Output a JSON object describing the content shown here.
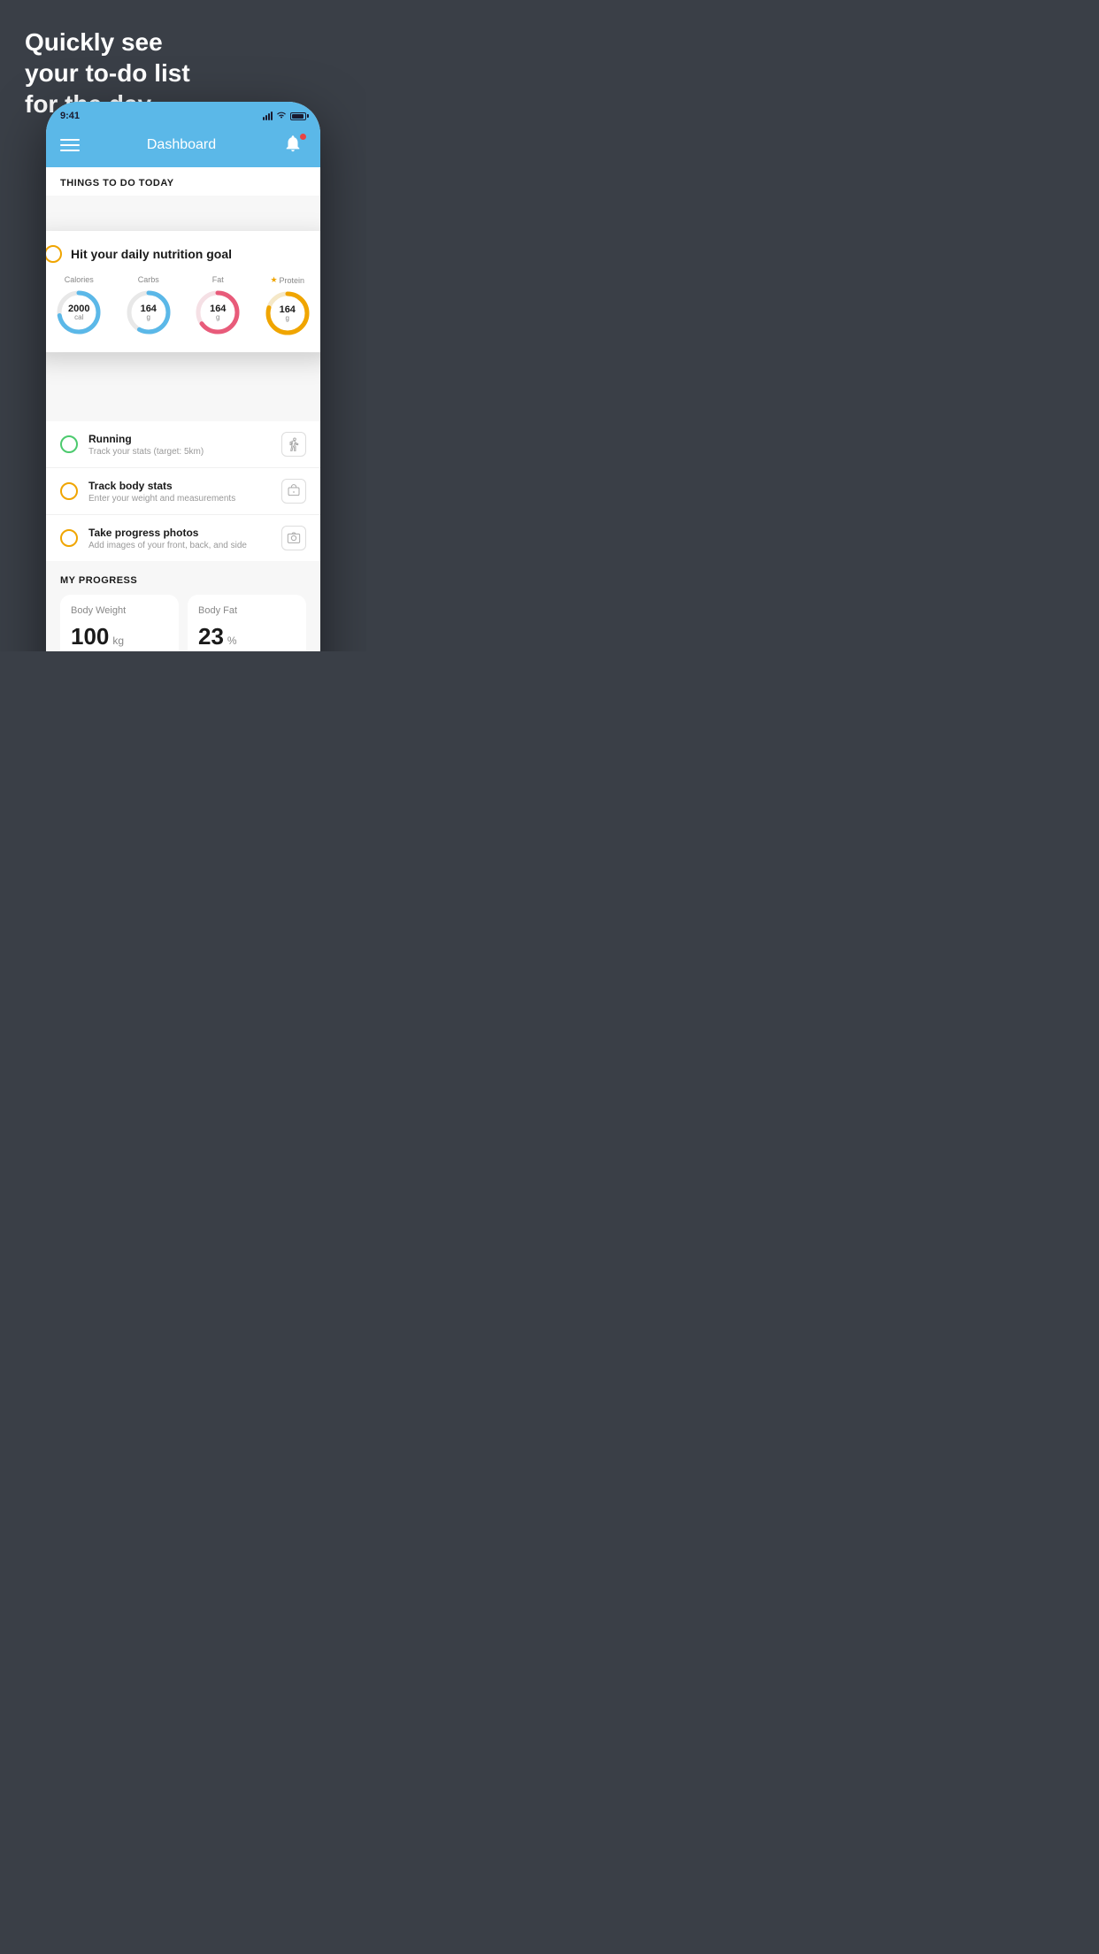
{
  "hero": {
    "line1": "Quickly see",
    "line2": "your to-do list",
    "line3": "for the day."
  },
  "phone": {
    "statusBar": {
      "time": "9:41"
    },
    "header": {
      "title": "Dashboard"
    },
    "todaySection": {
      "label": "THINGS TO DO TODAY"
    },
    "floatingCard": {
      "title": "Hit your daily nutrition goal",
      "nutrition": [
        {
          "label": "Calories",
          "value": "2000",
          "unit": "cal",
          "color": "#5bb8e8",
          "trackColor": "#e8e8e8",
          "starred": false
        },
        {
          "label": "Carbs",
          "value": "164",
          "unit": "g",
          "color": "#5bb8e8",
          "trackColor": "#e8e8e8",
          "starred": false
        },
        {
          "label": "Fat",
          "value": "164",
          "unit": "g",
          "color": "#e85b7a",
          "trackColor": "#f5e8ec",
          "starred": false
        },
        {
          "label": "Protein",
          "value": "164",
          "unit": "g",
          "color": "#f0a500",
          "trackColor": "#f5e8c8",
          "starred": true
        }
      ]
    },
    "todoItems": [
      {
        "title": "Running",
        "subtitle": "Track your stats (target: 5km)",
        "circleColor": "green",
        "icon": "shoe"
      },
      {
        "title": "Track body stats",
        "subtitle": "Enter your weight and measurements",
        "circleColor": "yellow",
        "icon": "scale"
      },
      {
        "title": "Take progress photos",
        "subtitle": "Add images of your front, back, and side",
        "circleColor": "yellow",
        "icon": "photo"
      }
    ],
    "progressSection": {
      "label": "MY PROGRESS",
      "cards": [
        {
          "title": "Body Weight",
          "value": "100",
          "unit": "kg"
        },
        {
          "title": "Body Fat",
          "value": "23",
          "unit": "%"
        }
      ]
    }
  }
}
